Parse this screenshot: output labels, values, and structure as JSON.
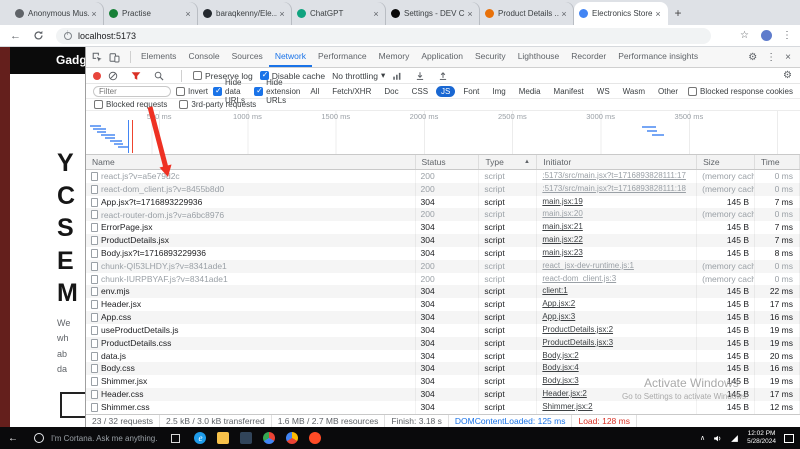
{
  "icons": {
    "back": "←",
    "star": "☆",
    "menu": "⋮",
    "gear": "⚙",
    "close": "×",
    "caret": "▾",
    "sort": "▲",
    "collapse": "∧"
  },
  "browser": {
    "tabs": [
      {
        "label": "Anonymous Mus...",
        "color": "#5f6368"
      },
      {
        "label": "Practise",
        "color": "#188038"
      },
      {
        "label": "baraqkenny/Ele...",
        "color": "#24292f"
      },
      {
        "label": "ChatGPT",
        "color": "#10a37f"
      },
      {
        "label": "Settings - DEV C...",
        "color": "#090909"
      },
      {
        "label": "Product Details ...",
        "color": "#e8710a"
      },
      {
        "label": "Electronics Store",
        "color": "#4285f4",
        "active": true
      }
    ],
    "new_tab": "+",
    "url": "localhost:5173"
  },
  "page": {
    "logo_fragment": "Gadg",
    "heading_letters": [
      "Y",
      "C",
      "S",
      "E",
      "M"
    ],
    "text_fragments": [
      "We",
      "wh",
      "ab",
      "da"
    ]
  },
  "devtools": {
    "tabs": [
      {
        "label": "Elements"
      },
      {
        "label": "Console"
      },
      {
        "label": "Sources"
      },
      {
        "label": "Network",
        "active": true
      },
      {
        "label": "Performance"
      },
      {
        "label": "Memory"
      },
      {
        "label": "Application"
      },
      {
        "label": "Security"
      },
      {
        "label": "Lighthouse"
      },
      {
        "label": "Recorder"
      },
      {
        "label": "Performance insights"
      }
    ],
    "network_toolbar": {
      "preserve_log": "Preserve log",
      "disable_cache": "Disable cache",
      "throttling": "No throttling"
    },
    "filter_bar": {
      "placeholder": "Filter",
      "invert": "Invert",
      "hide_data_urls": "Hide data URLs",
      "hide_extension_urls": "Hide extension URLs",
      "blocked_response_cookies": "Blocked response cookies",
      "chips": [
        {
          "label": "All"
        },
        {
          "label": "Fetch/XHR"
        },
        {
          "label": "Doc"
        },
        {
          "label": "CSS"
        },
        {
          "label": "JS",
          "selected": true
        },
        {
          "label": "Font"
        },
        {
          "label": "Img"
        },
        {
          "label": "Media"
        },
        {
          "label": "Manifest"
        },
        {
          "label": "WS"
        },
        {
          "label": "Wasm"
        },
        {
          "label": "Other"
        }
      ]
    },
    "options_row": {
      "blocked_requests": "Blocked requests",
      "third_party_requests": "3rd-party requests"
    },
    "timeline_labels": [
      "500 ms",
      "1000 ms",
      "1500 ms",
      "2000 ms",
      "2500 ms",
      "3000 ms",
      "3500 ms"
    ],
    "table": {
      "columns": [
        "Name",
        "Status",
        "Type",
        "Initiator",
        "Size",
        "Time"
      ],
      "rows": [
        {
          "name": "react.js?v=a5e79d2c",
          "status": "200",
          "type": "script",
          "initiator": ":5173/src/main.jsx?t=1716893828111:17",
          "size": "(memory cache)",
          "time": "0 ms",
          "cached": true
        },
        {
          "name": "react-dom_client.js?v=8455b8d0",
          "status": "200",
          "type": "script",
          "initiator": ":5173/src/main.jsx?t=1716893828111:18",
          "size": "(memory cache)",
          "time": "0 ms",
          "cached": true
        },
        {
          "name": "App.jsx?t=1716893229936",
          "status": "304",
          "type": "script",
          "initiator": "main.jsx:19",
          "size": "145 B",
          "time": "7 ms",
          "cached": false
        },
        {
          "name": "react-router-dom.js?v=a6bc8976",
          "status": "200",
          "type": "script",
          "initiator": "main.jsx:20",
          "size": "(memory cache)",
          "time": "0 ms",
          "cached": true
        },
        {
          "name": "ErrorPage.jsx",
          "status": "304",
          "type": "script",
          "initiator": "main.jsx:21",
          "size": "145 B",
          "time": "7 ms",
          "cached": false
        },
        {
          "name": "ProductDetails.jsx",
          "status": "304",
          "type": "script",
          "initiator": "main.jsx:22",
          "size": "145 B",
          "time": "7 ms",
          "cached": false
        },
        {
          "name": "Body.jsx?t=1716893229936",
          "status": "304",
          "type": "script",
          "initiator": "main.jsx:23",
          "size": "145 B",
          "time": "8 ms",
          "cached": false
        },
        {
          "name": "chunk-QI53LHDY.js?v=8341ade1",
          "status": "200",
          "type": "script",
          "initiator": "react_jsx-dev-runtime.js:1",
          "size": "(memory cache)",
          "time": "0 ms",
          "cached": true
        },
        {
          "name": "chunk-IURPBYAF.js?v=8341ade1",
          "status": "200",
          "type": "script",
          "initiator": "react-dom_client.js:3",
          "size": "(memory cache)",
          "time": "0 ms",
          "cached": true
        },
        {
          "name": "env.mjs",
          "status": "304",
          "type": "script",
          "initiator": "client:1",
          "size": "145 B",
          "time": "22 ms",
          "cached": false
        },
        {
          "name": "Header.jsx",
          "status": "304",
          "type": "script",
          "initiator": "App.jsx:2",
          "size": "145 B",
          "time": "17 ms",
          "cached": false
        },
        {
          "name": "App.css",
          "status": "304",
          "type": "script",
          "initiator": "App.jsx:3",
          "size": "145 B",
          "time": "16 ms",
          "cached": false
        },
        {
          "name": "useProductDetails.js",
          "status": "304",
          "type": "script",
          "initiator": "ProductDetails.jsx:2",
          "size": "145 B",
          "time": "19 ms",
          "cached": false
        },
        {
          "name": "ProductDetails.css",
          "status": "304",
          "type": "script",
          "initiator": "ProductDetails.jsx:3",
          "size": "145 B",
          "time": "19 ms",
          "cached": false
        },
        {
          "name": "data.js",
          "status": "304",
          "type": "script",
          "initiator": "Body.jsx:2",
          "size": "145 B",
          "time": "20 ms",
          "cached": false
        },
        {
          "name": "Body.css",
          "status": "304",
          "type": "script",
          "initiator": "Body.jsx:4",
          "size": "145 B",
          "time": "16 ms",
          "cached": false
        },
        {
          "name": "Shimmer.jsx",
          "status": "304",
          "type": "script",
          "initiator": "Body.jsx:3",
          "size": "145 B",
          "time": "19 ms",
          "cached": false
        },
        {
          "name": "Header.css",
          "status": "304",
          "type": "script",
          "initiator": "Header.jsx:2",
          "size": "145 B",
          "time": "17 ms",
          "cached": false
        },
        {
          "name": "Shimmer.css",
          "status": "304",
          "type": "script",
          "initiator": "Shimmer.jsx:2",
          "size": "145 B",
          "time": "12 ms",
          "cached": false
        }
      ]
    },
    "status_bar": [
      {
        "text": "23 / 32 requests"
      },
      {
        "text": "2.5 kB / 3.0 kB transferred"
      },
      {
        "text": "1.6 MB / 2.7 MB resources"
      },
      {
        "text": "Finish: 3.18 s"
      },
      {
        "text": "DOMContentLoaded: 125 ms",
        "color": "#1a73e8"
      },
      {
        "text": "Load: 128 ms",
        "color": "#d93025"
      }
    ]
  },
  "watermark": {
    "title": "Activate Windows",
    "subtitle": "Go to Settings to activate Windows."
  },
  "taskbar": {
    "cortana_text": "I'm Cortana. Ask me anything.",
    "time": "12:02 PM",
    "date": "5/28/2024",
    "apps": [
      {
        "name": "edge",
        "glyph": "e",
        "bg": "#1e9be9",
        "radius": "50%"
      },
      {
        "name": "file-explorer",
        "glyph": "",
        "bg": "#f7c14a",
        "radius": "2px"
      },
      {
        "name": "store",
        "glyph": "",
        "bg": "#31445a",
        "radius": "2px"
      },
      {
        "name": "chrome",
        "glyph": "",
        "bg": "conic-gradient(#ea4335 0 33%, #4285f4 33% 66%, #34a853 66% 100%)",
        "radius": "50%"
      },
      {
        "name": "browser-profile",
        "glyph": "",
        "bg": "conic-gradient(#fbbc05 0 33%, #ea4335 33% 66%, #4285f4 66% 100%)",
        "radius": "50%"
      },
      {
        "name": "opera",
        "glyph": "",
        "bg": "#ff4b26",
        "radius": "50%"
      }
    ]
  }
}
